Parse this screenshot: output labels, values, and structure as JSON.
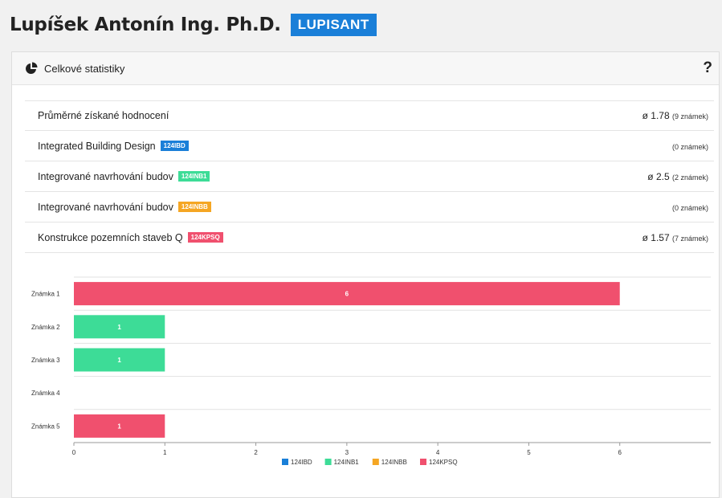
{
  "header": {
    "name": "Lupíšek Antonín Ing. Ph.D.",
    "username": "LUPISANT",
    "username_color": "#1a7fd8"
  },
  "panel": {
    "title": "Celkové statistiky",
    "icon": "pie-chart-icon",
    "help_label": "?"
  },
  "stats": {
    "overall": {
      "label": "Průměrné získané hodnocení",
      "avg": "ø 1.78",
      "count": "(9 známek)"
    },
    "courses": [
      {
        "label": "Integrated Building Design",
        "code": "124IBD",
        "color": "#1a7fd8",
        "avg": "",
        "count": "(0 známek)"
      },
      {
        "label": "Integrované navrhování budov",
        "code": "124INB1",
        "color": "#3ddc97",
        "avg": "ø 2.5",
        "count": "(2 známek)"
      },
      {
        "label": "Integrované navrhování budov",
        "code": "124INBB",
        "color": "#f5a623",
        "avg": "",
        "count": "(0 známek)"
      },
      {
        "label": "Konstrukce pozemních staveb Q",
        "code": "124KPSQ",
        "color": "#f0506e",
        "avg": "ø 1.57",
        "count": "(7 známek)"
      }
    ]
  },
  "chart_data": {
    "type": "bar",
    "orientation": "horizontal",
    "stacked": true,
    "categories": [
      "Známka 1",
      "Známka 2",
      "Známka 3",
      "Známka 4",
      "Známka 5"
    ],
    "xlim": [
      0,
      7
    ],
    "xticks": [
      0,
      1,
      2,
      3,
      4,
      5,
      6
    ],
    "legend_position": "bottom",
    "series": [
      {
        "name": "124IBD",
        "color": "#1a7fd8",
        "values": [
          0,
          0,
          0,
          0,
          0
        ]
      },
      {
        "name": "124INB1",
        "color": "#3ddc97",
        "values": [
          0,
          1,
          1,
          0,
          0
        ]
      },
      {
        "name": "124INBB",
        "color": "#f5a623",
        "values": [
          0,
          0,
          0,
          0,
          0
        ]
      },
      {
        "name": "124KPSQ",
        "color": "#f0506e",
        "values": [
          6,
          0,
          0,
          0,
          1
        ]
      }
    ]
  }
}
